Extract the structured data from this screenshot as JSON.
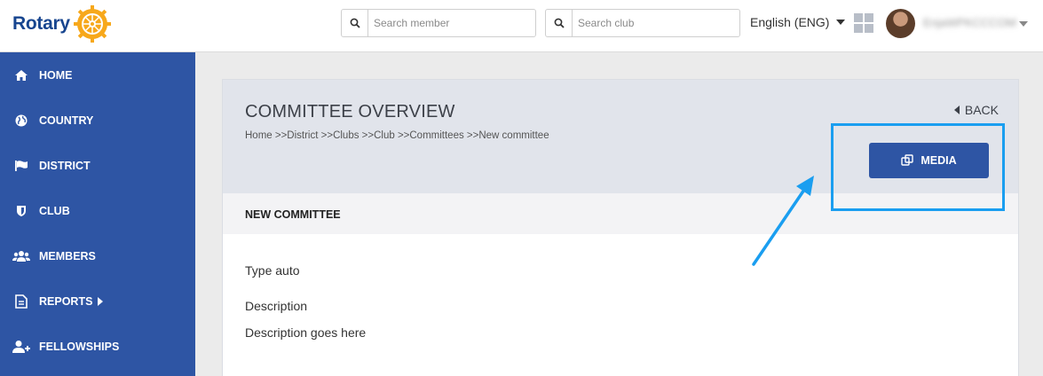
{
  "header": {
    "logo_text": "Rotary",
    "search_member_placeholder": "Search member",
    "search_club_placeholder": "Search club",
    "language": "English (ENG)",
    "username": "EnjaWPKCCCOM"
  },
  "sidebar": {
    "items": [
      {
        "label": "HOME",
        "icon": "home-icon"
      },
      {
        "label": "COUNTRY",
        "icon": "globe-icon"
      },
      {
        "label": "DISTRICT",
        "icon": "flag-icon"
      },
      {
        "label": "CLUB",
        "icon": "shield-icon"
      },
      {
        "label": "MEMBERS",
        "icon": "users-icon"
      },
      {
        "label": "REPORTS",
        "icon": "document-icon",
        "has_submenu": true
      },
      {
        "label": "FELLOWSHIPS",
        "icon": "user-plus-icon"
      }
    ]
  },
  "main": {
    "title": "COMMITTEE OVERVIEW",
    "breadcrumb": "Home >>District >>Clubs >>Club >>Committees >>New committee",
    "back_label": "BACK",
    "media_label": "MEDIA",
    "section_title": "NEW COMMITTEE",
    "type_text": "Type auto",
    "description_label": "Description",
    "description_value": "Description goes here"
  },
  "colors": {
    "primary": "#2e55a4",
    "rotary_blue": "#17458f",
    "rotary_gold": "#f7a81b",
    "annotation": "#1a9ef0"
  }
}
